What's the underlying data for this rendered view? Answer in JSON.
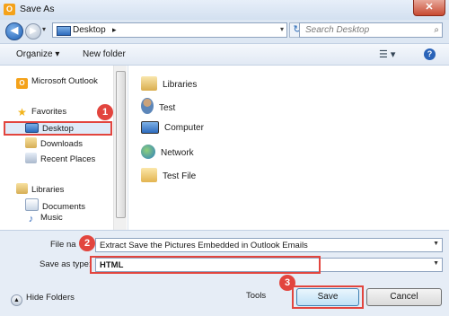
{
  "window": {
    "title": "Save As",
    "close_label": "✕"
  },
  "nav": {
    "path_root": "Desktop",
    "path_sep": "▸",
    "search_placeholder": "Search Desktop"
  },
  "toolbar": {
    "organize": "Organize ▾",
    "new_folder": "New folder",
    "views": "☰ ▾",
    "help": "?"
  },
  "sidebar": {
    "items": [
      {
        "label": "Microsoft Outlook",
        "icon": "outlook-icon"
      },
      {
        "label": "Favorites",
        "icon": "star-icon"
      },
      {
        "label": "Desktop",
        "icon": "desktop-icon"
      },
      {
        "label": "Downloads",
        "icon": "downloads-icon"
      },
      {
        "label": "Recent Places",
        "icon": "recent-places-icon"
      },
      {
        "label": "Libraries",
        "icon": "libraries-icon"
      },
      {
        "label": "Documents",
        "icon": "documents-icon"
      },
      {
        "label": "Music",
        "icon": "music-icon"
      }
    ]
  },
  "files": {
    "items": [
      {
        "label": "Libraries",
        "icon": "libraries-icon"
      },
      {
        "label": "Test",
        "icon": "user-folder-icon"
      },
      {
        "label": "Computer",
        "icon": "computer-icon"
      },
      {
        "label": "Network",
        "icon": "network-icon"
      },
      {
        "label": "Test File",
        "icon": "folder-icon"
      }
    ]
  },
  "form": {
    "file_name_label": "File na",
    "file_name_value": "Extract  Save the Pictures Embedded in Outlook Emails",
    "save_type_label": "Save as type:",
    "save_type_value": "HTML"
  },
  "footer": {
    "hide_folders": "Hide Folders",
    "tools": "Tools",
    "save": "Save",
    "cancel": "Cancel"
  },
  "annotations": {
    "badge1": "1",
    "badge2": "2",
    "badge3": "3",
    "highlight_color": "#e2453e"
  }
}
